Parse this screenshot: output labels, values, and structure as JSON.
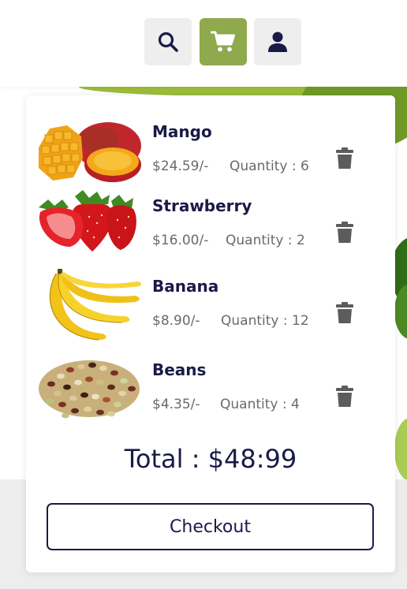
{
  "header": {
    "icons": [
      "search-icon",
      "cart-icon",
      "user-icon"
    ],
    "active_color": "#8fa94d"
  },
  "cart": {
    "items": [
      {
        "name": "Mango",
        "price": "$24.59/-",
        "quantity": "Quantity : 6",
        "image": "mango"
      },
      {
        "name": "Strawberry",
        "price": "$16.00/-",
        "quantity": "Quantity : 2",
        "image": "strawberry"
      },
      {
        "name": "Banana",
        "price": "$8.90/-",
        "quantity": "Quantity : 12",
        "image": "banana"
      },
      {
        "name": "Beans",
        "price": "$4.35/-",
        "quantity": "Quantity : 4",
        "image": "beans"
      }
    ],
    "total": "Total : $48:99",
    "checkout_label": "Checkout"
  },
  "colors": {
    "text": "#1a1a48",
    "muted": "#6a6a6a",
    "accent": "#8fa94d"
  }
}
